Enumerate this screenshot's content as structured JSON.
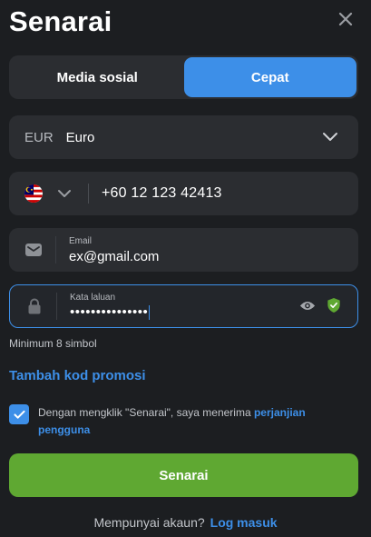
{
  "header": {
    "title": "Senarai",
    "close_icon": "close-icon"
  },
  "tabs": [
    {
      "label": "Media sosial",
      "active": false
    },
    {
      "label": "Cepat",
      "active": true
    }
  ],
  "currency": {
    "code": "EUR",
    "name": "Euro",
    "icon": "chevron-down-icon"
  },
  "phone": {
    "country_flag": "malaysia-flag-icon",
    "value": "+60 12 123 42413"
  },
  "email": {
    "label": "Email",
    "value": "ex@gmail.com",
    "icon": "envelope-icon"
  },
  "password": {
    "label": "Kata laluan",
    "value": "•••••••••••••••",
    "icon": "lock-icon",
    "show_icon": "eye-icon",
    "strength_icon": "shield-check-icon"
  },
  "password_hint": "Minimum 8 simbol",
  "promo_link": "Tambah kod promosi",
  "agreement": {
    "checked": true,
    "text": "Dengan mengklik \"Senarai\", saya menerima ",
    "link": "perjanjian pengguna"
  },
  "submit_label": "Senarai",
  "footer": {
    "question": "Mempunyai akaun?",
    "login_link": "Log masuk"
  },
  "colors": {
    "background": "#1c1e21",
    "field": "#2b2d31",
    "accent": "#3d8fe8",
    "primary_button": "#5fa832",
    "shield": "#5fa832"
  }
}
